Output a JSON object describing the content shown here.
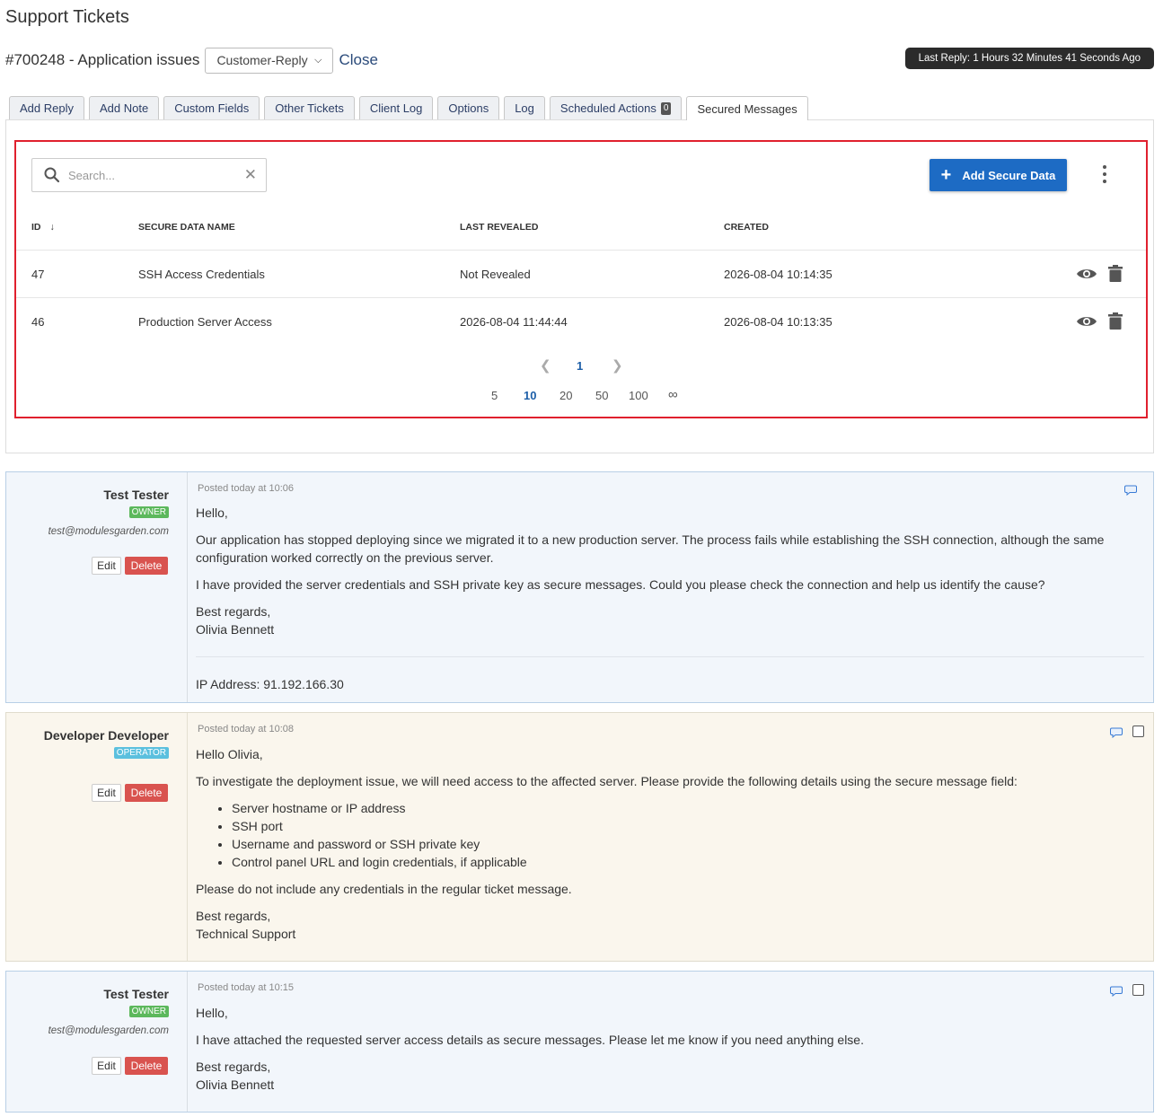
{
  "page_title": "Support Tickets",
  "ticket": {
    "title": "#700248 - Application issues",
    "status": "Customer-Reply",
    "close_label": "Close",
    "last_reply": "Last Reply: 1 Hours 32 Minutes 41 Seconds Ago"
  },
  "tabs": [
    {
      "label": "Add Reply"
    },
    {
      "label": "Add Note"
    },
    {
      "label": "Custom Fields"
    },
    {
      "label": "Other Tickets"
    },
    {
      "label": "Client Log"
    },
    {
      "label": "Options"
    },
    {
      "label": "Log"
    },
    {
      "label": "Scheduled Actions",
      "badge": "0"
    },
    {
      "label": "Secured Messages"
    }
  ],
  "secure": {
    "search_placeholder": "Search...",
    "add_label": "Add Secure Data",
    "columns": {
      "id": "ID",
      "name": "SECURE DATA NAME",
      "last_revealed": "LAST REVEALED",
      "created": "CREATED"
    },
    "rows": [
      {
        "id": "47",
        "name": "SSH Access Credentials",
        "last_revealed": "Not Revealed",
        "created": "2026-08-04 10:14:35"
      },
      {
        "id": "46",
        "name": "Production Server Access",
        "last_revealed": "2026-08-04 11:44:44",
        "created": "2026-08-04 10:13:35"
      }
    ],
    "current_page": "1",
    "page_sizes": [
      "5",
      "10",
      "20",
      "50",
      "100",
      "∞"
    ],
    "active_page_size": "10"
  },
  "posts": [
    {
      "author": "Test Tester",
      "role": "OWNER",
      "email": "test@modulesgarden.com",
      "edit_label": "Edit",
      "delete_label": "Delete",
      "posted": "Posted today at 10:06",
      "greeting": "Hello,",
      "p1": "Our application has stopped deploying since we migrated it to a new production server. The process fails while establishing the SSH connection, although the same configuration worked correctly on the previous server.",
      "p2": "I have provided the server credentials and SSH private key as secure messages. Could you please check the connection and help us identify the cause?",
      "closing": "Best regards,",
      "signature": "Olivia Bennett",
      "ip": "IP Address: 91.192.166.30"
    },
    {
      "author": "Developer Developer",
      "role": "OPERATOR",
      "edit_label": "Edit",
      "delete_label": "Delete",
      "posted": "Posted today at 10:08",
      "greeting": "Hello Olivia,",
      "p1": "To investigate the deployment issue, we will need access to the affected server. Please provide the following details using the secure message field:",
      "list": [
        "Server hostname or IP address",
        "SSH port",
        "Username and password or SSH private key",
        "Control panel URL and login credentials, if applicable"
      ],
      "p2": "Please do not include any credentials in the regular ticket message.",
      "closing": "Best regards,",
      "signature": "Technical Support"
    },
    {
      "author": "Test Tester",
      "role": "OWNER",
      "email": "test@modulesgarden.com",
      "edit_label": "Edit",
      "delete_label": "Delete",
      "posted": "Posted today at 10:15",
      "greeting": "Hello,",
      "p1": "I have attached the requested server access details as secure messages. Please let me know if you need anything else.",
      "closing": "Best regards,",
      "signature": "Olivia Bennett"
    }
  ],
  "colors": {
    "accent": "#1d6bc4",
    "highlight_border": "#e0202e",
    "owner_badge": "#5cb85c",
    "operator_badge": "#5bc0de",
    "delete": "#d9534f"
  }
}
